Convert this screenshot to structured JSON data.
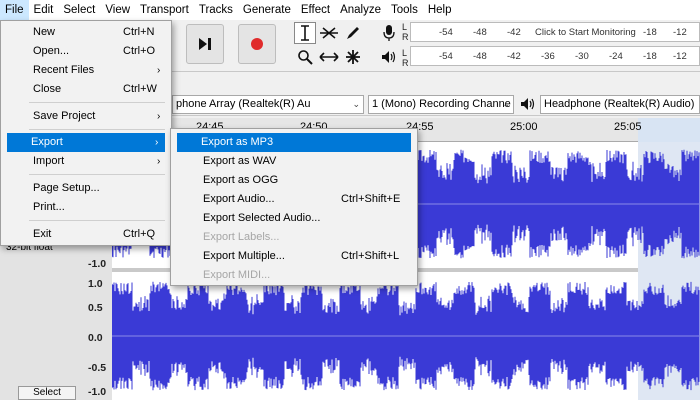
{
  "menubar": [
    "File",
    "Edit",
    "Select",
    "View",
    "Transport",
    "Tracks",
    "Generate",
    "Effect",
    "Analyze",
    "Tools",
    "Help"
  ],
  "meter": {
    "record_labels": [
      "-54",
      "-48",
      "-42"
    ],
    "monitor_text": "Click to Start Monitoring",
    "record_right": [
      "-18",
      "-12"
    ],
    "play_labels": [
      "-54",
      "-48",
      "-42",
      "-36",
      "-30",
      "-24",
      "-18",
      "-12"
    ],
    "lr": [
      "L",
      "R"
    ]
  },
  "devices": {
    "input": "phone Array (Realtek(R) Au",
    "channels": "1 (Mono) Recording Channe",
    "output": "Headphone (Realtek(R) Audio)"
  },
  "timeline": [
    "24:45",
    "24:50",
    "24:55",
    "25:00",
    "25:05"
  ],
  "track": {
    "format": "32-bit float",
    "select_label": "Select",
    "scale": [
      "-1.0",
      "1.0",
      "0.5",
      "0.0",
      "-0.5",
      "-1.0"
    ]
  },
  "file_menu": {
    "items": [
      {
        "label": "New",
        "shortcut": "Ctrl+N"
      },
      {
        "label": "Open...",
        "shortcut": "Ctrl+O"
      },
      {
        "label": "Recent Files",
        "sub": "›"
      },
      {
        "label": "Close",
        "shortcut": "Ctrl+W"
      },
      {
        "label": "Save Project",
        "sub": "›"
      },
      {
        "label": "Export",
        "sub": "›"
      },
      {
        "label": "Import",
        "sub": "›"
      },
      {
        "label": "Page Setup..."
      },
      {
        "label": "Print..."
      },
      {
        "label": "Exit",
        "shortcut": "Ctrl+Q"
      }
    ]
  },
  "export_menu": {
    "items": [
      {
        "label": "Export as MP3"
      },
      {
        "label": "Export as WAV"
      },
      {
        "label": "Export as OGG"
      },
      {
        "label": "Export Audio...",
        "shortcut": "Ctrl+Shift+E"
      },
      {
        "label": "Export Selected Audio..."
      },
      {
        "label": "Export Labels..."
      },
      {
        "label": "Export Multiple...",
        "shortcut": "Ctrl+Shift+L"
      },
      {
        "label": "Export MIDI..."
      }
    ]
  },
  "colors": {
    "wave": "#3a3ad6",
    "highlight": "#0078d7",
    "hover": "#cce8ff",
    "record": "#e02b2b"
  }
}
